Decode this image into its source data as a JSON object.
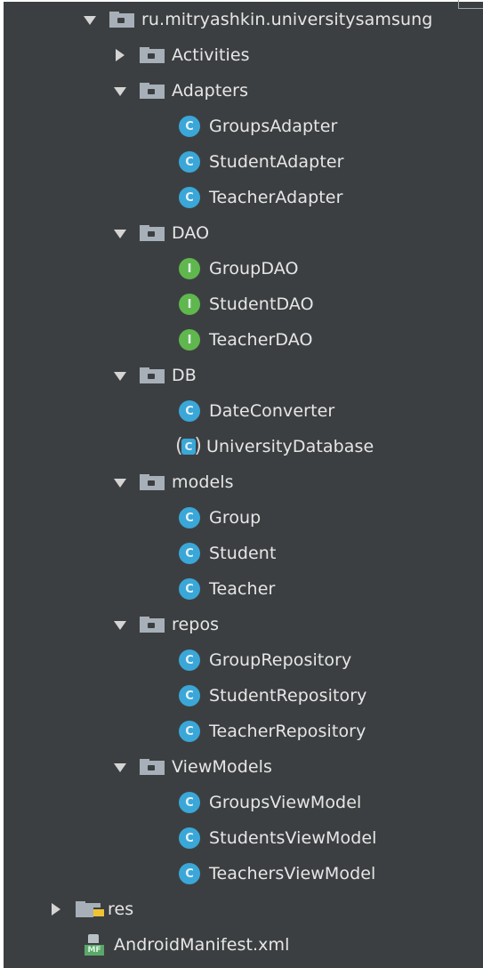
{
  "tree": {
    "package": "ru.mitryashkin.universitysamsung",
    "items": {
      "activities": "Activities",
      "adapters": "Adapters",
      "groupsAdapter": "GroupsAdapter",
      "studentAdapter": "StudentAdapter",
      "teacherAdapter": "TeacherAdapter",
      "dao": "DAO",
      "groupDAO": "GroupDAO",
      "studentDAO": "StudentDAO",
      "teacherDAO": "TeacherDAO",
      "db": "DB",
      "dateConverter": "DateConverter",
      "universityDatabase": "UniversityDatabase",
      "models": "models",
      "group": "Group",
      "student": "Student",
      "teacher": "Teacher",
      "repos": "repos",
      "groupRepository": "GroupRepository",
      "studentRepository": "StudentRepository",
      "teacherRepository": "TeacherRepository",
      "viewModels": "ViewModels",
      "groupsViewModel": "GroupsViewModel",
      "studentsViewModel": "StudentsViewModel",
      "teachersViewModel": "TeachersViewModel",
      "res": "res",
      "androidManifest": "AndroidManifest.xml"
    },
    "icons": {
      "class_letter": "C",
      "interface_letter": "I",
      "manifest_badge": "MF"
    },
    "colors": {
      "background": "#3c3f41",
      "text": "#e6e6e6",
      "class_icon": "#3aa7d8",
      "interface_icon": "#5fb74d",
      "folder_icon": "#a7b0b8",
      "resource_badge": "#f1c232",
      "manifest_badge": "#59a869"
    }
  }
}
